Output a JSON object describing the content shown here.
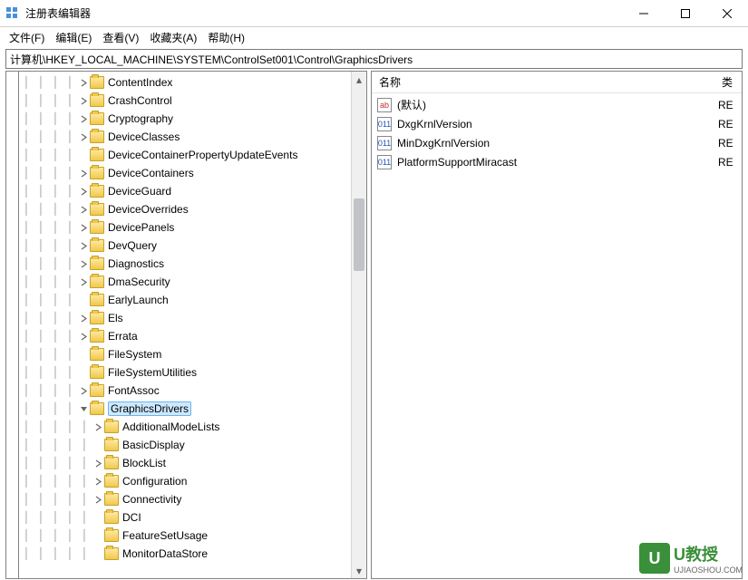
{
  "window": {
    "title": "注册表编辑器"
  },
  "menu": {
    "file": "文件(F)",
    "edit": "编辑(E)",
    "view": "查看(V)",
    "fav": "收藏夹(A)",
    "help": "帮助(H)"
  },
  "address": "计算机\\HKEY_LOCAL_MACHINE\\SYSTEM\\ControlSet001\\Control\\GraphicsDrivers",
  "tree": [
    {
      "name": "ContentIndex",
      "depth": 4,
      "exp": ">"
    },
    {
      "name": "CrashControl",
      "depth": 4,
      "exp": ">"
    },
    {
      "name": "Cryptography",
      "depth": 4,
      "exp": ">"
    },
    {
      "name": "DeviceClasses",
      "depth": 4,
      "exp": ">"
    },
    {
      "name": "DeviceContainerPropertyUpdateEvents",
      "depth": 4,
      "exp": ""
    },
    {
      "name": "DeviceContainers",
      "depth": 4,
      "exp": ">"
    },
    {
      "name": "DeviceGuard",
      "depth": 4,
      "exp": ">"
    },
    {
      "name": "DeviceOverrides",
      "depth": 4,
      "exp": ">"
    },
    {
      "name": "DevicePanels",
      "depth": 4,
      "exp": ">"
    },
    {
      "name": "DevQuery",
      "depth": 4,
      "exp": ">"
    },
    {
      "name": "Diagnostics",
      "depth": 4,
      "exp": ">"
    },
    {
      "name": "DmaSecurity",
      "depth": 4,
      "exp": ">"
    },
    {
      "name": "EarlyLaunch",
      "depth": 4,
      "exp": ""
    },
    {
      "name": "Els",
      "depth": 4,
      "exp": ">"
    },
    {
      "name": "Errata",
      "depth": 4,
      "exp": ">"
    },
    {
      "name": "FileSystem",
      "depth": 4,
      "exp": ""
    },
    {
      "name": "FileSystemUtilities",
      "depth": 4,
      "exp": ""
    },
    {
      "name": "FontAssoc",
      "depth": 4,
      "exp": ">"
    },
    {
      "name": "GraphicsDrivers",
      "depth": 4,
      "exp": "v",
      "sel": true
    },
    {
      "name": "AdditionalModeLists",
      "depth": 5,
      "exp": ">"
    },
    {
      "name": "BasicDisplay",
      "depth": 5,
      "exp": ""
    },
    {
      "name": "BlockList",
      "depth": 5,
      "exp": ">"
    },
    {
      "name": "Configuration",
      "depth": 5,
      "exp": ">"
    },
    {
      "name": "Connectivity",
      "depth": 5,
      "exp": ">"
    },
    {
      "name": "DCI",
      "depth": 5,
      "exp": ""
    },
    {
      "name": "FeatureSetUsage",
      "depth": 5,
      "exp": ""
    },
    {
      "name": "MonitorDataStore",
      "depth": 5,
      "exp": ""
    }
  ],
  "list": {
    "cols": {
      "name": "名称",
      "type": "类"
    },
    "rows": [
      {
        "icon": "str",
        "name": "(默认)",
        "type": "RE"
      },
      {
        "icon": "bin",
        "name": "DxgKrnlVersion",
        "type": "RE"
      },
      {
        "icon": "bin",
        "name": "MinDxgKrnlVersion",
        "type": "RE"
      },
      {
        "icon": "bin",
        "name": "PlatformSupportMiracast",
        "type": "RE"
      }
    ]
  },
  "branding": {
    "logo_letter": "U",
    "logo_text": "U教授",
    "url": "UJIAOSHOU.COM"
  }
}
